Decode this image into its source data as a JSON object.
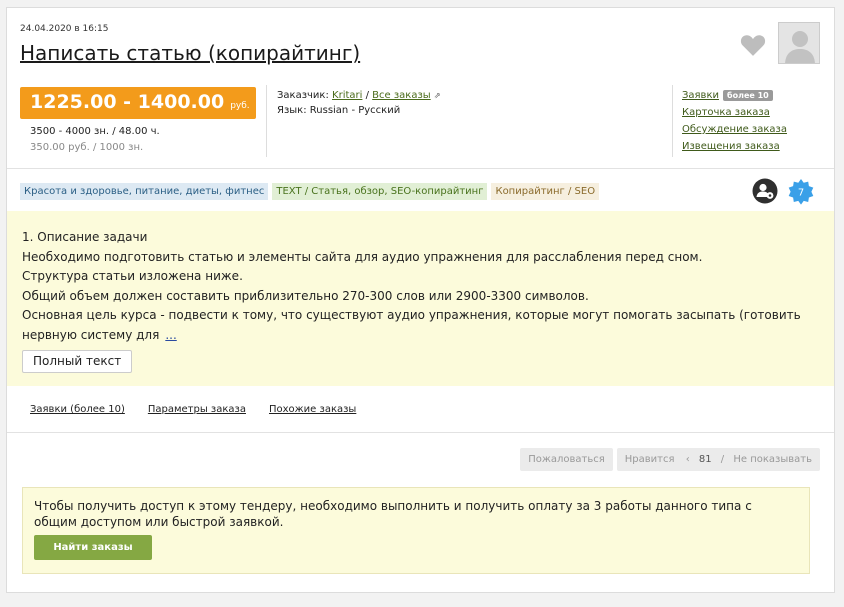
{
  "order": {
    "date": "24.04.2020 в 16:15",
    "title": "Написать статью (копирайтинг)",
    "price_amount": "1225.00 - 1400.00",
    "price_currency": "руб.",
    "volume": "3500 - 4000 зн. / 48.00 ч.",
    "rate": "350.00 руб. / 1000 зн."
  },
  "info": {
    "customer_label": "Заказчик:",
    "customer_name": "Kritari",
    "separator": "/",
    "all_orders": "Все заказы",
    "language_label": "Язык:",
    "language_value": "Russian - Русский"
  },
  "side_links": {
    "bids": "Заявки",
    "bids_badge": "более 10",
    "card": "Карточка заказа",
    "discussion": "Обсуждение заказа",
    "notifications": "Извещения заказа"
  },
  "tags": [
    "Красота и здоровье, питание, диеты, фитнес",
    "TEXT / Статья, обзор, SEO-копирайтинг",
    "Копирайтинг / SEO"
  ],
  "badge_count": "7",
  "description": {
    "lines": [
      "1. Описание задачи",
      "Необходимо подготовить статью и элементы сайта для аудио упражнения для расслабления перед сном.",
      "Структура статьи изложена ниже.",
      "Общий объем должен составить приблизительно 270-300 слов или 2900-3300 символов.",
      "Основная цель курса - подвести к тому, что существуют аудио упражнения, которые могут помогать засыпать (готовить нервную систему для"
    ],
    "more": "...",
    "full_text_button": "Полный текст"
  },
  "subnav": {
    "bids": "Заявки (более 10)",
    "params": "Параметры заказа",
    "similar": "Похожие заказы"
  },
  "actions": {
    "complain": "Пожаловаться",
    "like": "Нравится",
    "like_arrow": "‹",
    "like_count": "81",
    "separator": "/",
    "hide": "Не показывать"
  },
  "notice": {
    "text": "Чтобы получить доступ к этому тендеру, необходимо выполнить и получить оплату за 3 работы данного типа с общим доступом или быстрой заявкой.",
    "button": "Найти заказы"
  },
  "colors": {
    "price_bg": "#f39b1b",
    "highlight_bg": "#fcfbdb",
    "button_green": "#85a843",
    "badge_blue": "#3aa0e8"
  }
}
